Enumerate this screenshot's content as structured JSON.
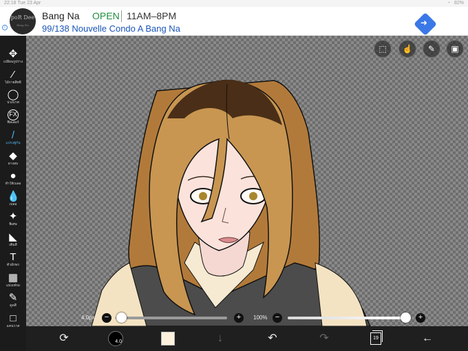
{
  "statusbar": {
    "time": "22:18",
    "date": "Tue 23 Apr",
    "battery": "82%"
  },
  "ad": {
    "info_icon": "info-icon",
    "logo_text": "poR Dee",
    "logo_sub": "Bang Na",
    "name": "Bang Na",
    "status": "OPEN",
    "hours": "11AM–8PM",
    "address": "99/138 Nouvelle Condo A Bang Na",
    "directions_icon": "directions-icon",
    "open_color": "#1e8e3e",
    "link_color": "#1a55b8"
  },
  "tools": [
    {
      "icon": "✥",
      "label": "เปลี่ยนรูปร่าง",
      "name": "transform"
    },
    {
      "icon": "⁄",
      "label": "ไม้กายสิทธิ์",
      "name": "magic-wand"
    },
    {
      "icon": "◯",
      "label": "บ่วงบาศ",
      "name": "lasso"
    },
    {
      "icon": "FX",
      "label": "ฟิลเตอร์",
      "name": "filter"
    },
    {
      "icon": "/",
      "label": "แปรงพู่กัน",
      "name": "brush",
      "active": true
    },
    {
      "icon": "◆",
      "label": "ยางลบ",
      "name": "eraser"
    },
    {
      "icon": "●",
      "label": "ทำให้เบลอ",
      "name": "smudge"
    },
    {
      "icon": "💧",
      "label": "เบลอ",
      "name": "blur"
    },
    {
      "icon": "✦",
      "label": "พิเศษ",
      "name": "special"
    },
    {
      "icon": "◣",
      "label": "เติมสี",
      "name": "fill"
    },
    {
      "icon": "T",
      "label": "ตัวอักษร",
      "name": "text"
    },
    {
      "icon": "▦",
      "label": "แบ่งเฟรม",
      "name": "frame-divider"
    },
    {
      "icon": "✎",
      "label": "ดูดสี",
      "name": "eyedropper"
    },
    {
      "icon": "□",
      "label": "แคนวาส",
      "name": "canvas"
    }
  ],
  "topbuttons": [
    {
      "name": "selection-icon",
      "glyph": "⬚"
    },
    {
      "name": "hand-icon",
      "glyph": "☝"
    },
    {
      "name": "pen-icon",
      "glyph": "✎"
    },
    {
      "name": "image-icon",
      "glyph": "▣"
    }
  ],
  "sliders": {
    "size": {
      "value_label": "4.0px",
      "fraction": 0.05,
      "minus": "−",
      "plus": "+"
    },
    "opacity": {
      "value_label": "100%",
      "fraction": 1.0,
      "minus": "−",
      "plus": "+"
    }
  },
  "bottombar": {
    "brush_size": "4.0",
    "color": "#fdf1de",
    "layer_count": "19",
    "icons": [
      "transform-mini-icon",
      "brush-preview-icon",
      "color-swatch-icon",
      "download-icon",
      "undo-icon",
      "redo-icon",
      "layers-icon",
      "back-icon"
    ]
  }
}
